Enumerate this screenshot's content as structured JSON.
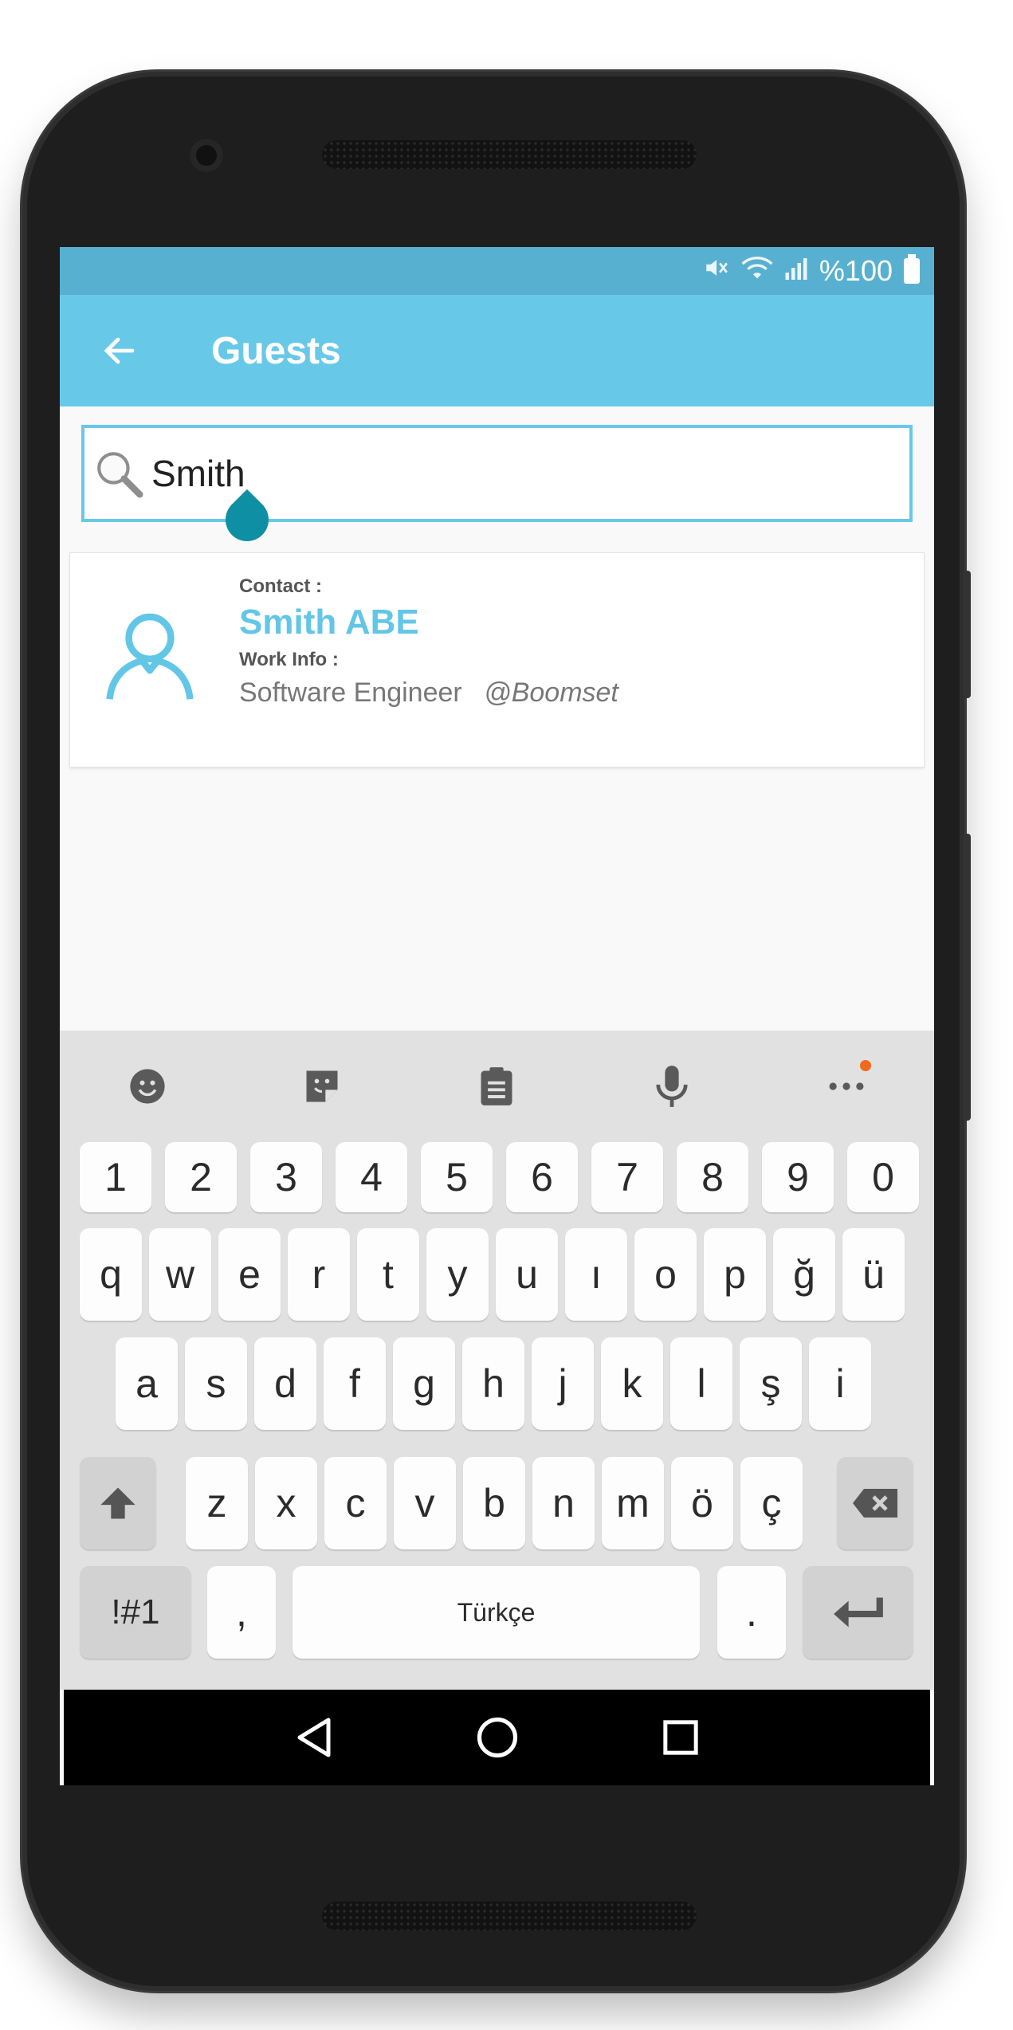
{
  "status_bar": {
    "battery_text": "%100",
    "icons": [
      "mute-icon",
      "wifi-icon",
      "signal-icon",
      "battery-icon"
    ]
  },
  "app_bar": {
    "title": "Guests",
    "back_icon": "arrow-left-icon"
  },
  "search": {
    "value": "Smith",
    "icon": "search-icon"
  },
  "result": {
    "contact_label": "Contact :",
    "name": "Smith ABE",
    "work_label": "Work Info :",
    "job_title": "Software Engineer",
    "company": "@Boomset",
    "avatar_icon": "person-icon"
  },
  "keyboard": {
    "toolbar": [
      "emoji-icon",
      "sticker-icon",
      "clipboard-icon",
      "microphone-icon",
      "more-icon"
    ],
    "number_row": [
      "1",
      "2",
      "3",
      "4",
      "5",
      "6",
      "7",
      "8",
      "9",
      "0"
    ],
    "row1": [
      "q",
      "w",
      "e",
      "r",
      "t",
      "y",
      "u",
      "ı",
      "o",
      "p",
      "ğ",
      "ü"
    ],
    "row2": [
      "a",
      "s",
      "d",
      "f",
      "g",
      "h",
      "j",
      "k",
      "l",
      "ş",
      "i"
    ],
    "row3": [
      "z",
      "x",
      "c",
      "v",
      "b",
      "n",
      "m",
      "ö",
      "ç"
    ],
    "symbols_label": "!#1",
    "comma": ",",
    "space_label": "Türkçe",
    "period": "."
  },
  "colors": {
    "accent": "#68c8e8",
    "status_bar": "#58b0d0",
    "cursor_handle": "#0e8fa3",
    "name_text": "#62c6e7"
  }
}
